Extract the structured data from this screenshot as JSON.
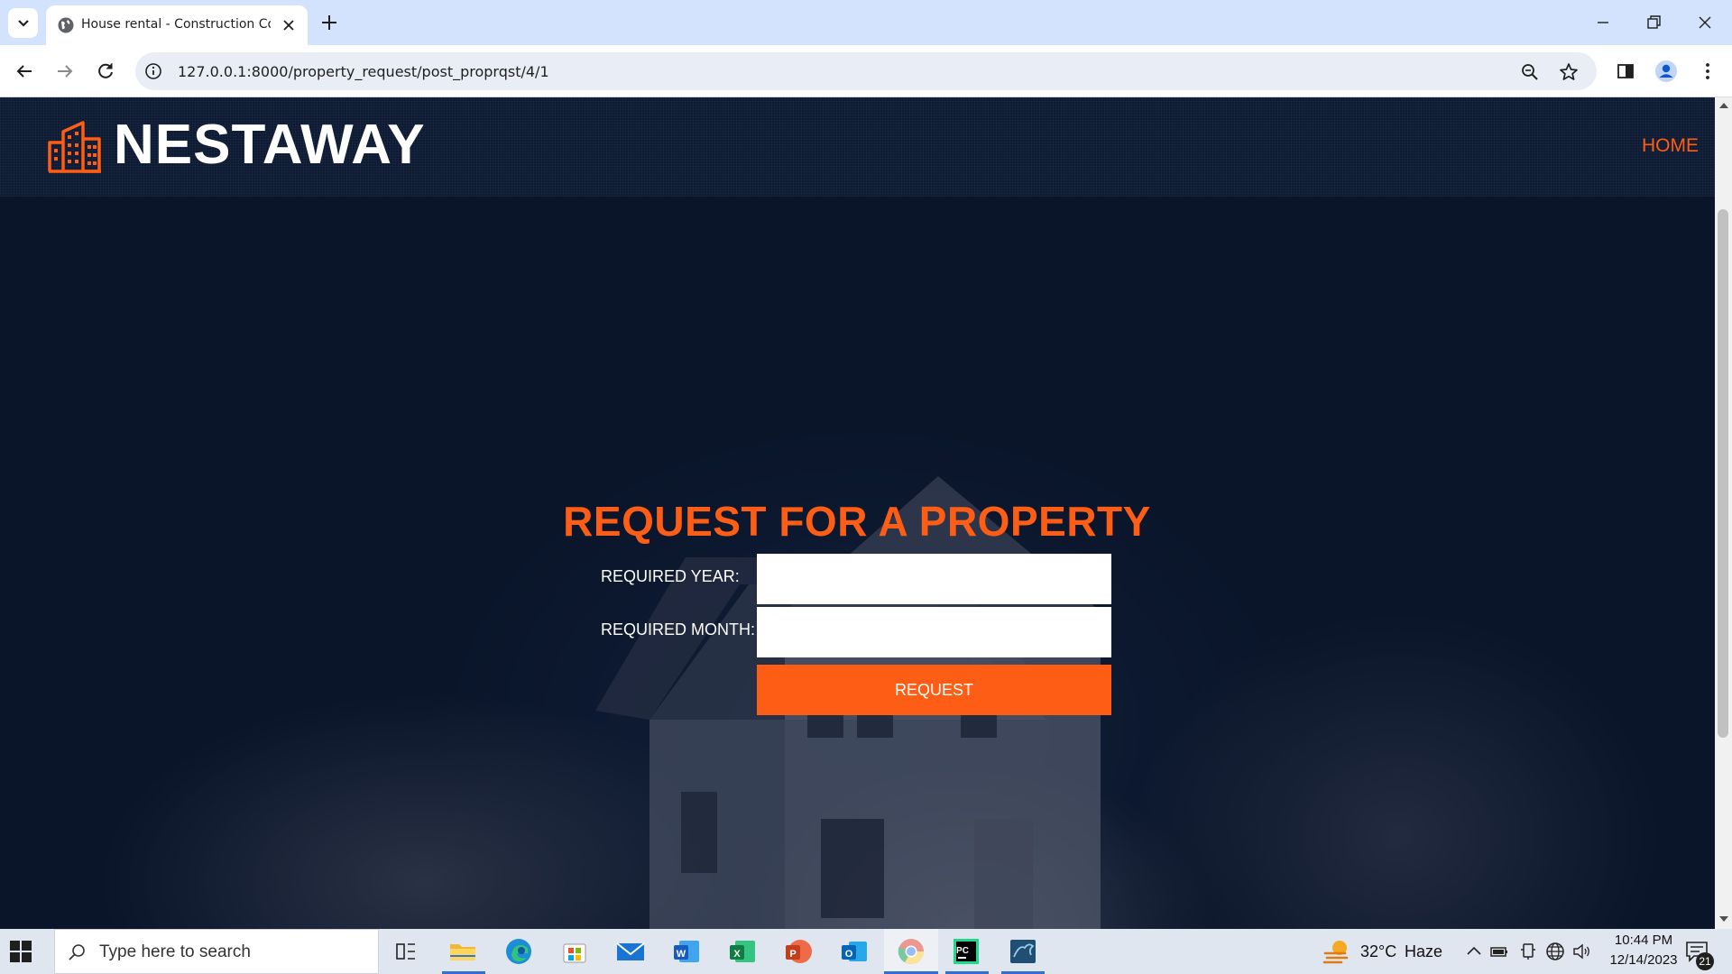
{
  "browser": {
    "tab_title": "House rental - Construction Co",
    "url": "127.0.0.1:8000/property_request/post_proprqst/4/1"
  },
  "site": {
    "brand": "NESTAWAY",
    "nav_home": "HOME",
    "accent_color": "#fd5d14"
  },
  "form": {
    "title": "REQUEST FOR A PROPERTY",
    "year_label": "REQUIRED YEAR:",
    "year_value": "",
    "month_label": "REQUIRED MONTH:",
    "month_value": "",
    "submit_label": "REQUEST"
  },
  "taskbar": {
    "search_placeholder": "Type here to search",
    "weather_temp": "32°C",
    "weather_desc": "Haze",
    "time": "10:44 PM",
    "date": "12/14/2023",
    "notification_count": "21",
    "apps": [
      "task-view-icon",
      "file-explorer-icon",
      "edge-icon",
      "store-icon",
      "mail-icon",
      "word-icon",
      "excel-icon",
      "powerpoint-icon",
      "outlook-icon",
      "chrome-icon",
      "pycharm-icon",
      "mysql-workbench-icon"
    ]
  }
}
